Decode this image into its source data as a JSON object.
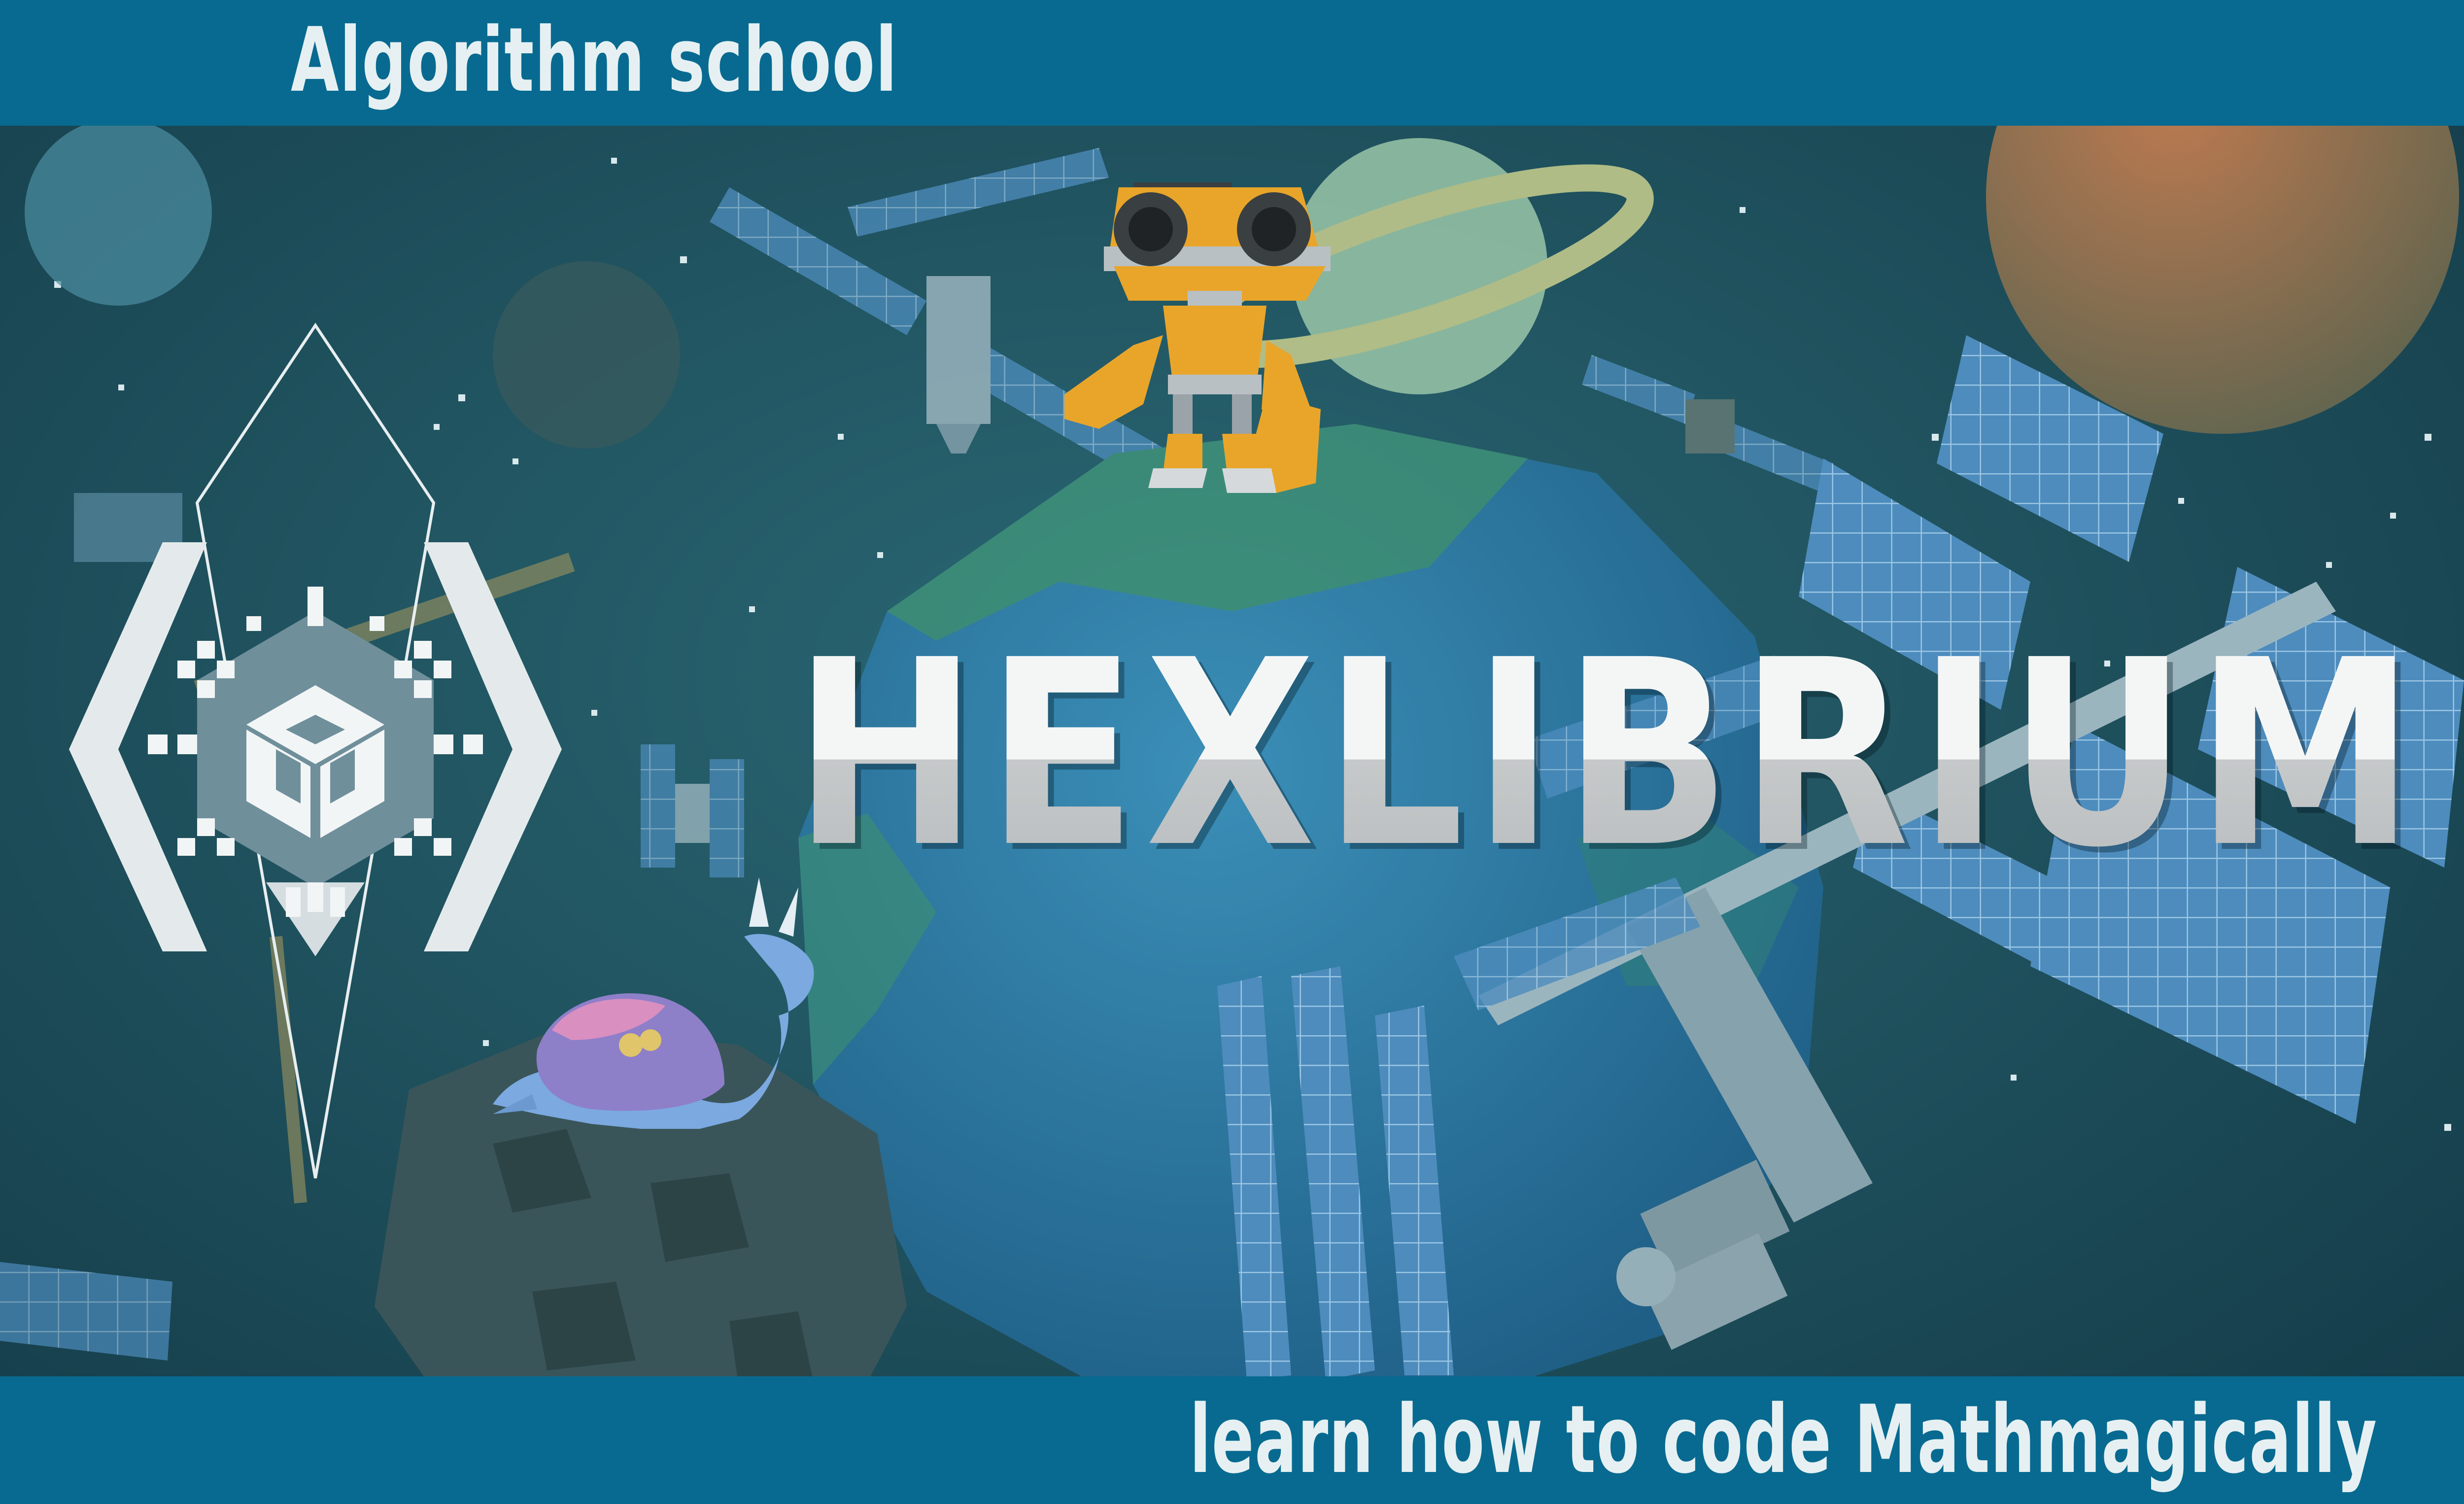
{
  "header": {
    "title": "Algorithm school"
  },
  "hero": {
    "title": "HEXLIBRIUM"
  },
  "footer": {
    "tagline": "learn how to code Mathmagically"
  },
  "colors": {
    "bar": "#086a90",
    "space": "#1e4f5e",
    "planet_earth": "#2a78a0",
    "robot": "#e8a325",
    "solar_panel": "#4f8fbf",
    "emblem": "#e8eef0"
  },
  "icons": [
    "hex-diamond-emblem-icon",
    "cube-icon",
    "robot-character",
    "turtle-dragon-character",
    "space-station",
    "planet"
  ]
}
